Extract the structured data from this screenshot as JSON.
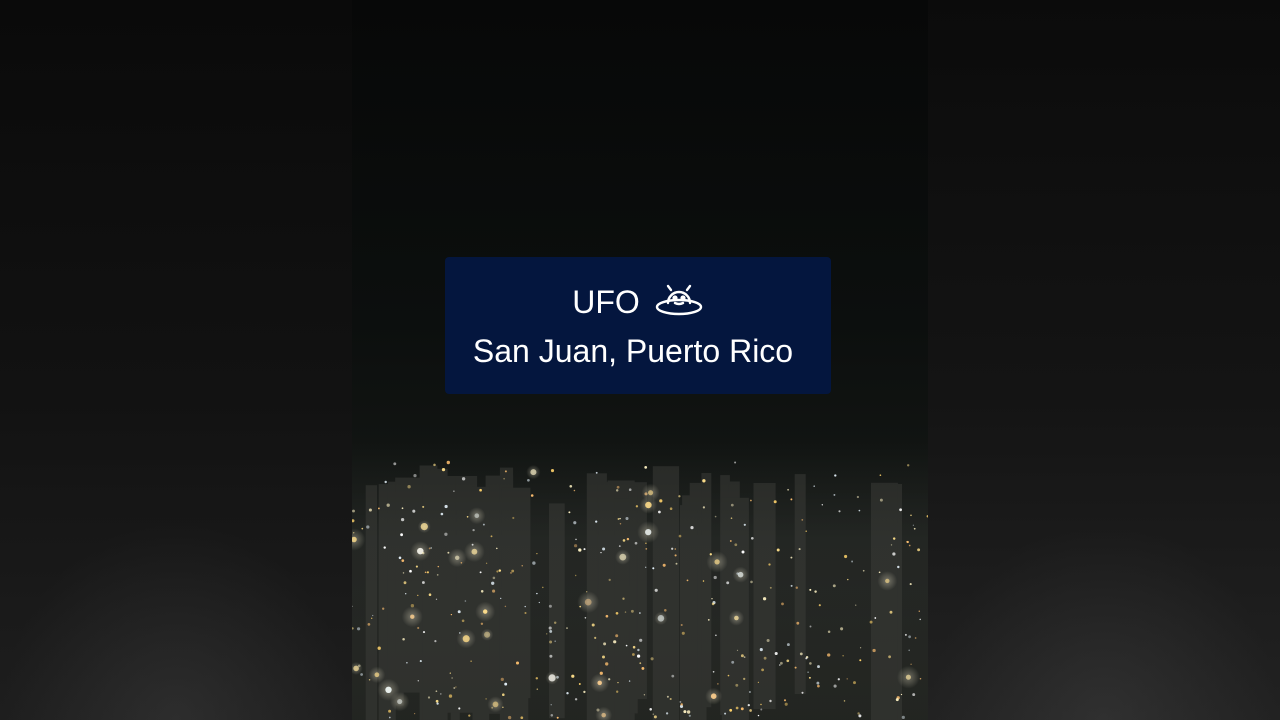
{
  "caption": {
    "title": "UFO",
    "location": "San Juan, Puerto Rico",
    "icon": "ufo-icon"
  },
  "colors": {
    "caption_background": "#04163e",
    "caption_text": "#ffffff",
    "sky": "#070808"
  }
}
